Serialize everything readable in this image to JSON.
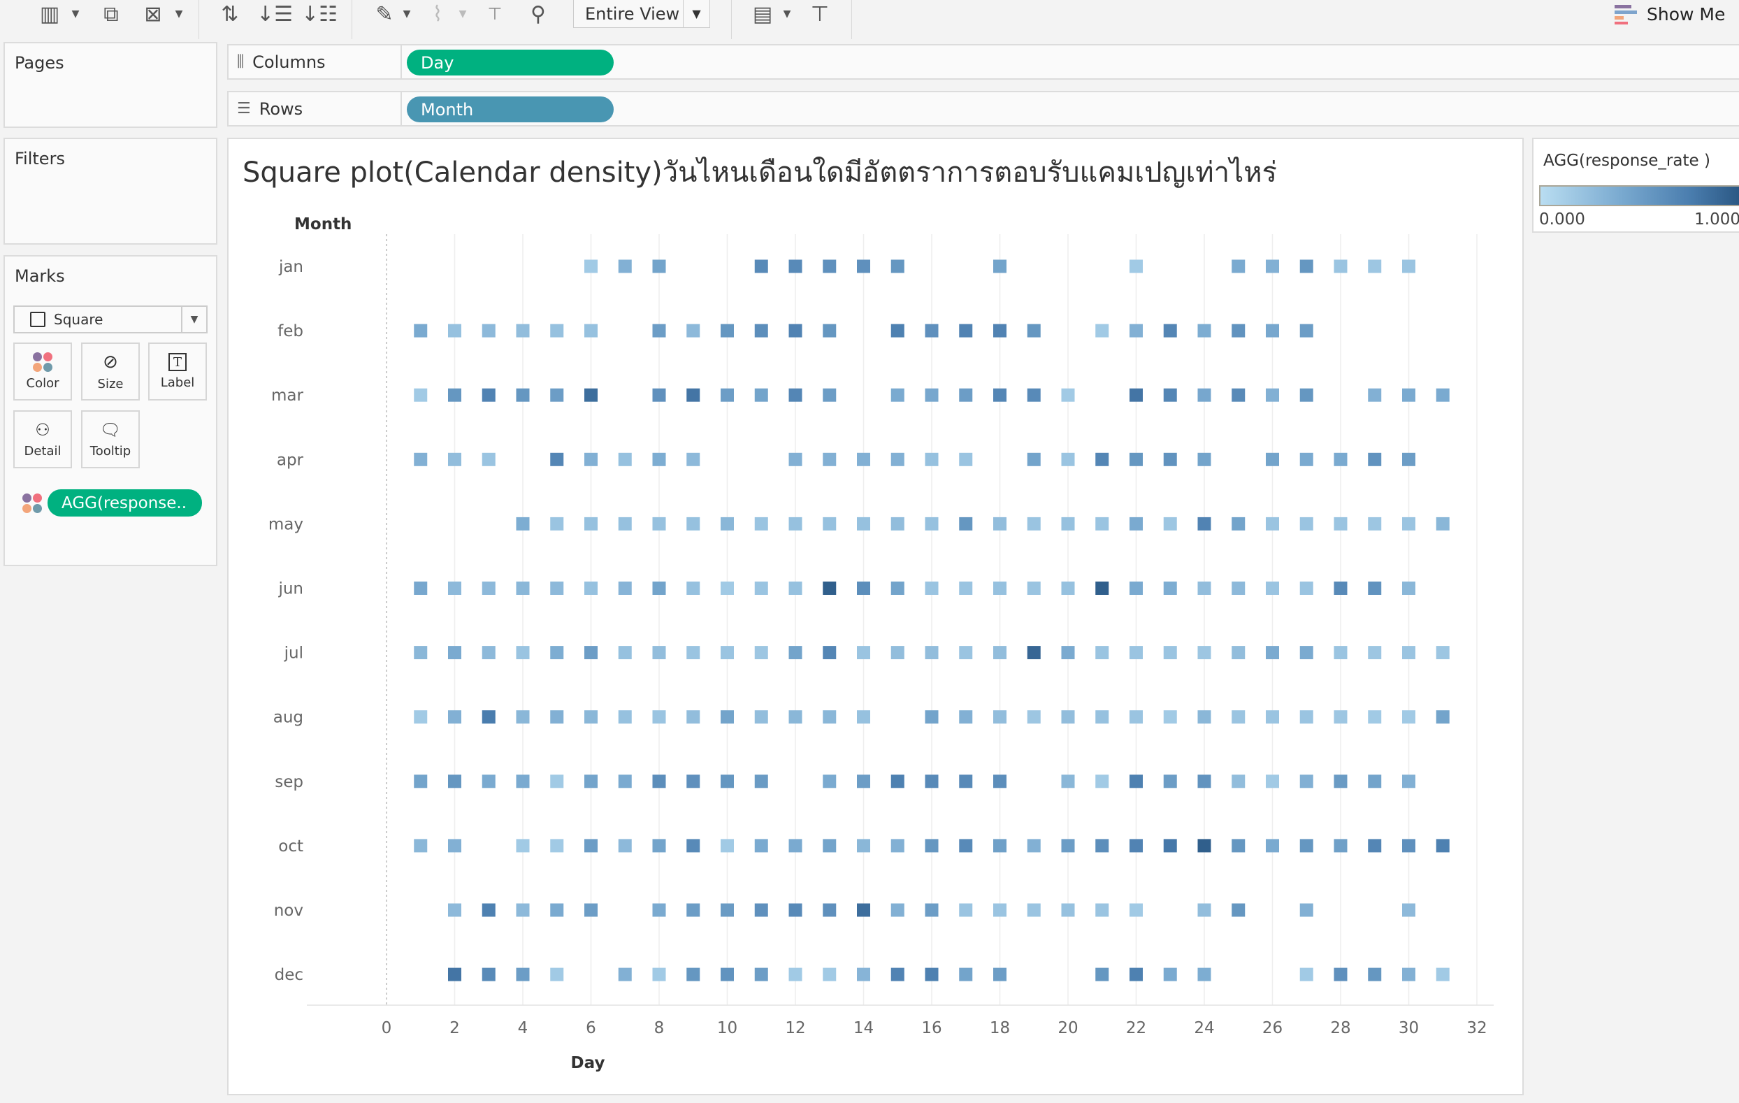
{
  "toolbar": {
    "icons": [
      "new-worksheet-icon",
      "duplicate-sheet-icon",
      "clear-sheet-icon",
      "swap-icon",
      "sort-ascending-icon",
      "sort-descending-icon",
      "highlight-icon",
      "group-icon",
      "label-icon",
      "pin-icon",
      "show-cards-icon",
      "presentation-icon"
    ],
    "fit_label": "Entire View",
    "show_me_label": "Show Me"
  },
  "panels": {
    "pages": "Pages",
    "filters": "Filters",
    "marks": "Marks",
    "mark_type": "Square",
    "buttons": {
      "color": "Color",
      "size": "Size",
      "label": "Label",
      "detail": "Detail",
      "tooltip": "Tooltip"
    },
    "color_pill": "AGG(response.."
  },
  "shelves": {
    "columns_label": "Columns",
    "columns_pill": "Day",
    "rows_label": "Rows",
    "rows_pill": "Month",
    "columns_color": "#00b180",
    "rows_color": "#4996b2"
  },
  "legend": {
    "title": "AGG(response_rate )",
    "min_label": "0.000",
    "max_label": "1.000",
    "color_low": "#b9ddf1",
    "color_high": "#2a5783"
  },
  "chart_data": {
    "type": "heatmap",
    "title": "Square plot(Calendar density)วันไหนเดือนใดมีอัตตราการตอบรับแคมเปญเท่าไหร่",
    "xlabel": "Day",
    "ylabel": "Month",
    "xlim": [
      0,
      32
    ],
    "x_ticks": [
      "0",
      "2",
      "4",
      "6",
      "8",
      "10",
      "12",
      "14",
      "16",
      "18",
      "20",
      "22",
      "24",
      "26",
      "28",
      "30",
      "32"
    ],
    "color_range": [
      0,
      1
    ],
    "months": [
      "jan",
      "feb",
      "mar",
      "apr",
      "may",
      "jun",
      "jul",
      "aug",
      "sep",
      "oct",
      "nov",
      "dec"
    ],
    "values": {
      "jan": {
        "6": 0.15,
        "7": 0.35,
        "8": 0.45,
        "11": 0.65,
        "12": 0.65,
        "13": 0.6,
        "14": 0.6,
        "15": 0.55,
        "18": 0.45,
        "22": 0.15,
        "25": 0.4,
        "26": 0.35,
        "27": 0.55,
        "28": 0.2,
        "29": 0.18,
        "30": 0.2
      },
      "feb": {
        "1": 0.4,
        "2": 0.22,
        "3": 0.28,
        "4": 0.25,
        "5": 0.22,
        "6": 0.22,
        "8": 0.5,
        "9": 0.28,
        "10": 0.55,
        "11": 0.62,
        "12": 0.7,
        "13": 0.55,
        "15": 0.72,
        "16": 0.6,
        "17": 0.7,
        "18": 0.7,
        "19": 0.55,
        "21": 0.15,
        "22": 0.35,
        "23": 0.68,
        "24": 0.38,
        "25": 0.58,
        "26": 0.42,
        "27": 0.5
      },
      "mar": {
        "1": 0.15,
        "2": 0.55,
        "3": 0.7,
        "4": 0.55,
        "5": 0.5,
        "6": 0.85,
        "8": 0.6,
        "9": 0.8,
        "10": 0.5,
        "11": 0.45,
        "12": 0.68,
        "13": 0.5,
        "15": 0.4,
        "16": 0.42,
        "17": 0.5,
        "18": 0.68,
        "19": 0.65,
        "20": 0.15,
        "22": 0.8,
        "23": 0.68,
        "24": 0.42,
        "25": 0.65,
        "26": 0.35,
        "27": 0.55,
        "29": 0.35,
        "30": 0.4,
        "31": 0.4
      },
      "apr": {
        "1": 0.35,
        "2": 0.25,
        "3": 0.2,
        "5": 0.68,
        "6": 0.35,
        "7": 0.22,
        "8": 0.38,
        "9": 0.28,
        "12": 0.35,
        "13": 0.35,
        "14": 0.35,
        "15": 0.35,
        "16": 0.22,
        "17": 0.2,
        "19": 0.45,
        "20": 0.2,
        "21": 0.68,
        "22": 0.55,
        "23": 0.58,
        "24": 0.45,
        "26": 0.45,
        "27": 0.4,
        "28": 0.4,
        "29": 0.58,
        "30": 0.5
      },
      "may": {
        "4": 0.38,
        "5": 0.2,
        "6": 0.22,
        "7": 0.22,
        "8": 0.22,
        "9": 0.22,
        "10": 0.3,
        "11": 0.2,
        "12": 0.22,
        "13": 0.22,
        "14": 0.22,
        "15": 0.25,
        "16": 0.22,
        "17": 0.55,
        "18": 0.25,
        "19": 0.2,
        "20": 0.22,
        "21": 0.2,
        "22": 0.4,
        "23": 0.18,
        "24": 0.7,
        "25": 0.45,
        "26": 0.2,
        "27": 0.2,
        "28": 0.2,
        "29": 0.18,
        "30": 0.2,
        "31": 0.3
      },
      "jun": {
        "1": 0.42,
        "2": 0.28,
        "3": 0.28,
        "4": 0.3,
        "5": 0.28,
        "6": 0.22,
        "7": 0.32,
        "8": 0.45,
        "9": 0.22,
        "10": 0.15,
        "11": 0.2,
        "12": 0.22,
        "13": 0.95,
        "14": 0.62,
        "15": 0.45,
        "16": 0.2,
        "17": 0.2,
        "18": 0.22,
        "19": 0.2,
        "20": 0.22,
        "21": 0.95,
        "22": 0.4,
        "23": 0.38,
        "24": 0.25,
        "25": 0.28,
        "26": 0.2,
        "27": 0.2,
        "28": 0.65,
        "29": 0.58,
        "30": 0.3
      },
      "jul": {
        "1": 0.3,
        "2": 0.4,
        "3": 0.28,
        "4": 0.2,
        "5": 0.38,
        "6": 0.5,
        "7": 0.22,
        "8": 0.25,
        "9": 0.2,
        "10": 0.2,
        "11": 0.18,
        "12": 0.45,
        "13": 0.68,
        "14": 0.2,
        "15": 0.25,
        "16": 0.25,
        "17": 0.2,
        "18": 0.25,
        "19": 0.9,
        "20": 0.4,
        "21": 0.2,
        "22": 0.2,
        "23": 0.2,
        "24": 0.18,
        "25": 0.25,
        "26": 0.4,
        "27": 0.4,
        "28": 0.2,
        "29": 0.18,
        "30": 0.2,
        "31": 0.18
      },
      "aug": {
        "1": 0.15,
        "2": 0.35,
        "3": 0.75,
        "4": 0.3,
        "5": 0.35,
        "6": 0.3,
        "7": 0.22,
        "8": 0.2,
        "9": 0.25,
        "10": 0.45,
        "11": 0.25,
        "12": 0.3,
        "13": 0.3,
        "14": 0.22,
        "16": 0.45,
        "17": 0.35,
        "18": 0.25,
        "19": 0.18,
        "20": 0.25,
        "21": 0.22,
        "22": 0.2,
        "23": 0.15,
        "24": 0.3,
        "25": 0.2,
        "26": 0.2,
        "27": 0.2,
        "28": 0.18,
        "29": 0.15,
        "30": 0.15,
        "31": 0.45
      },
      "sep": {
        "1": 0.45,
        "2": 0.55,
        "3": 0.4,
        "4": 0.4,
        "5": 0.15,
        "6": 0.45,
        "7": 0.4,
        "8": 0.62,
        "9": 0.6,
        "10": 0.55,
        "11": 0.52,
        "13": 0.4,
        "14": 0.5,
        "15": 0.72,
        "16": 0.65,
        "17": 0.65,
        "18": 0.62,
        "20": 0.3,
        "21": 0.15,
        "22": 0.72,
        "23": 0.5,
        "24": 0.58,
        "25": 0.25,
        "26": 0.15,
        "27": 0.35,
        "28": 0.52,
        "29": 0.45,
        "30": 0.35
      },
      "oct": {
        "1": 0.3,
        "2": 0.35,
        "4": 0.15,
        "5": 0.15,
        "6": 0.5,
        "7": 0.28,
        "8": 0.45,
        "9": 0.65,
        "10": 0.15,
        "11": 0.4,
        "12": 0.4,
        "13": 0.45,
        "14": 0.3,
        "15": 0.35,
        "16": 0.55,
        "17": 0.65,
        "18": 0.48,
        "19": 0.35,
        "20": 0.5,
        "21": 0.62,
        "22": 0.7,
        "23": 0.78,
        "24": 0.95,
        "25": 0.55,
        "26": 0.4,
        "27": 0.55,
        "28": 0.48,
        "29": 0.68,
        "30": 0.6,
        "31": 0.72
      },
      "nov": {
        "2": 0.28,
        "3": 0.72,
        "4": 0.28,
        "5": 0.4,
        "6": 0.5,
        "8": 0.4,
        "9": 0.5,
        "10": 0.52,
        "11": 0.6,
        "12": 0.65,
        "13": 0.6,
        "14": 0.85,
        "15": 0.35,
        "16": 0.5,
        "17": 0.2,
        "18": 0.2,
        "19": 0.2,
        "20": 0.22,
        "21": 0.2,
        "22": 0.15,
        "24": 0.25,
        "25": 0.55,
        "27": 0.35,
        "30": 0.28
      },
      "dec": {
        "2": 0.8,
        "3": 0.65,
        "4": 0.5,
        "5": 0.15,
        "7": 0.35,
        "8": 0.15,
        "9": 0.55,
        "10": 0.58,
        "11": 0.5,
        "12": 0.15,
        "13": 0.15,
        "14": 0.32,
        "15": 0.7,
        "16": 0.72,
        "17": 0.45,
        "18": 0.5,
        "21": 0.55,
        "22": 0.72,
        "23": 0.4,
        "24": 0.38,
        "27": 0.15,
        "28": 0.6,
        "29": 0.55,
        "30": 0.35,
        "31": 0.15
      }
    }
  }
}
